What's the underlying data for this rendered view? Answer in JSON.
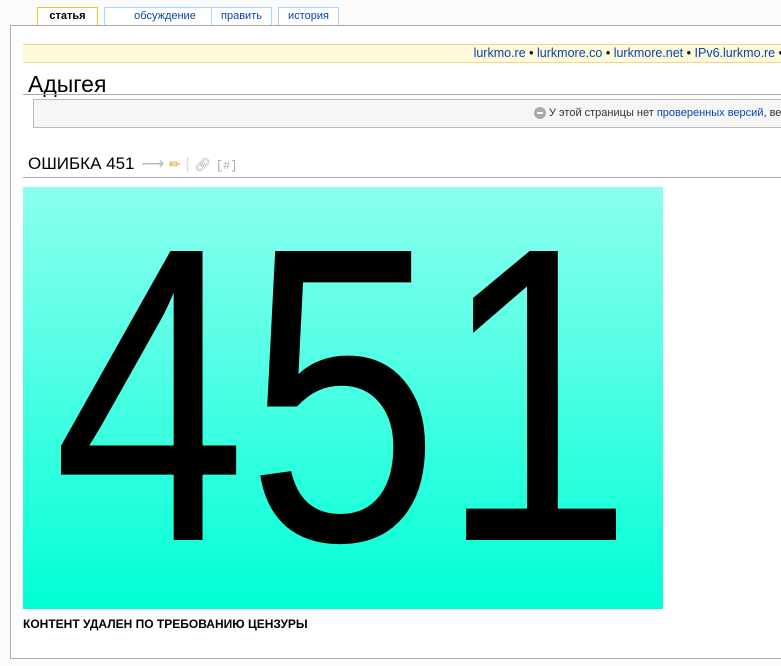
{
  "tabs": [
    {
      "label": "статья",
      "active": true
    },
    {
      "label": "обсуждение",
      "active": false
    },
    {
      "label": "править",
      "active": false
    },
    {
      "label": "история",
      "active": false
    }
  ],
  "mirrors": {
    "links": [
      "lurkmo.re",
      "lurkmore.co",
      "lurkmore.net",
      "IPv6.lurkmo.re"
    ],
    "separator": "•"
  },
  "page": {
    "title": "Адыгея"
  },
  "flagged": {
    "text_before": "У этой страницы нет",
    "link": "проверенных версий",
    "text_after": ", вер"
  },
  "section": {
    "heading": "ОШИБКА 451",
    "anchor": "[#]"
  },
  "banner": {
    "number": "451",
    "gradient_top": "#8cffef",
    "gradient_bottom": "#00ffd6"
  },
  "caption": "КОНТЕНТ УДАЛЕН ПО ТРЕБОВАНИЮ ЦЕНЗУРЫ",
  "colors": {
    "link": "#0645ad",
    "active_tab_border": "#fabd23",
    "mirror_bar_bg": "#fff9db"
  }
}
